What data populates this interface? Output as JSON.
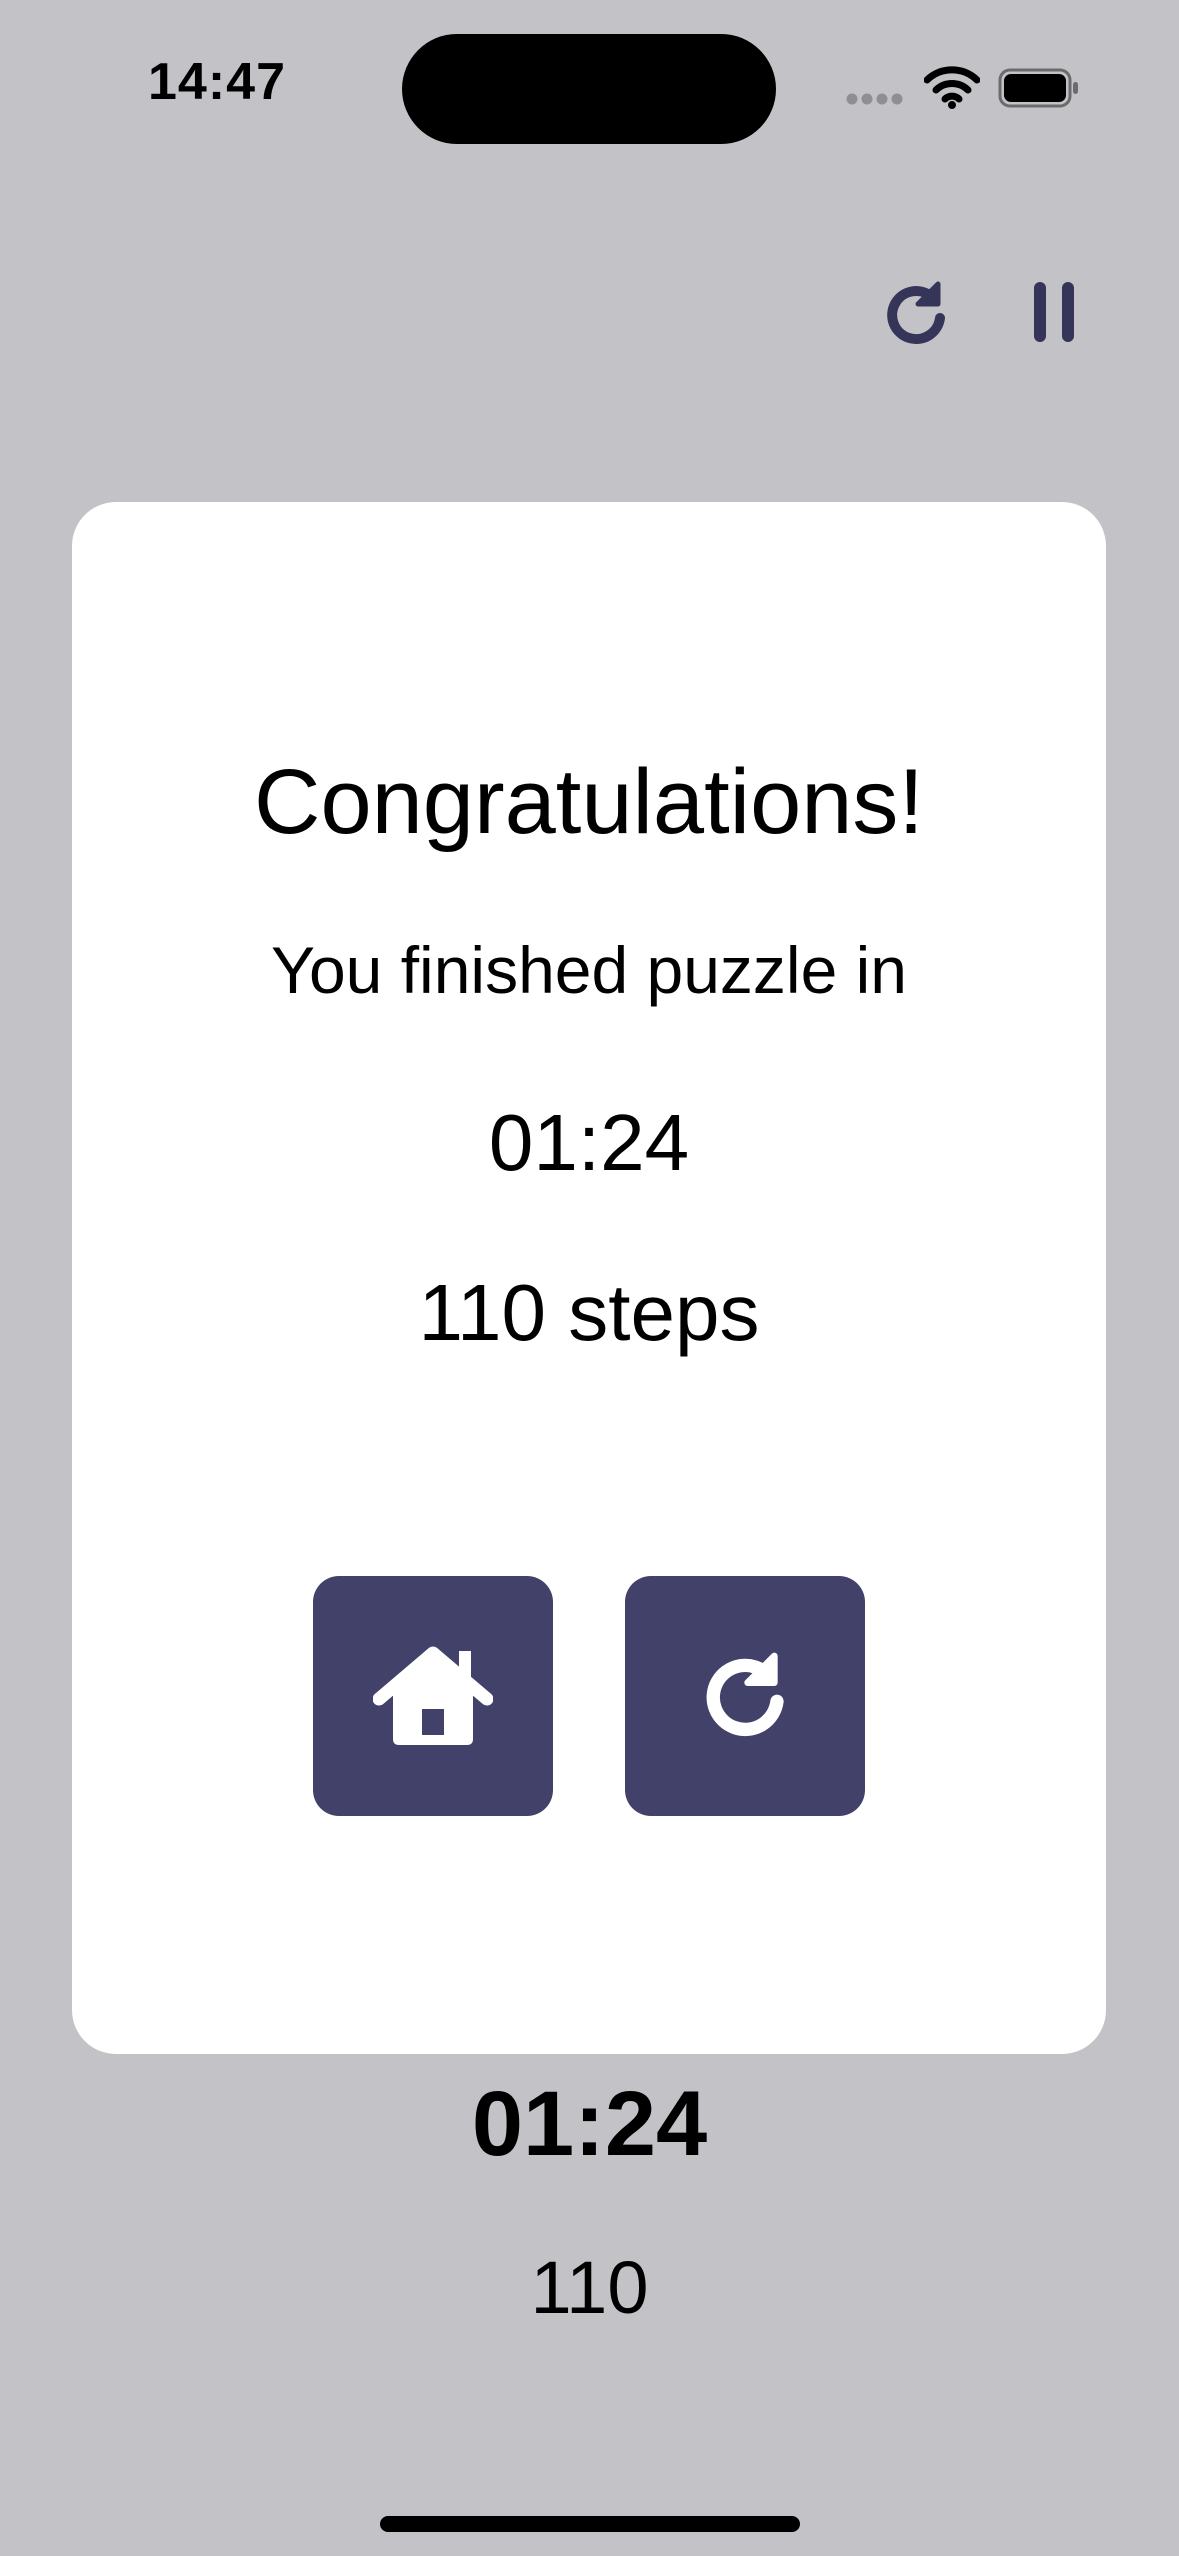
{
  "status_bar": {
    "time": "14:47"
  },
  "icons": {
    "top_restart": "restart-icon",
    "top_pause": "pause-icon",
    "home": "home-icon",
    "retry": "restart-icon"
  },
  "colors": {
    "background": "#c3c2c7",
    "card": "#ffffff",
    "accent": "#41416a",
    "text": "#000000"
  },
  "dialog": {
    "title": "Congratulations!",
    "subtitle": "You finished puzzle in",
    "time": "01:24",
    "steps": "110 steps"
  },
  "game": {
    "timer": "01:24",
    "moves": "110"
  }
}
